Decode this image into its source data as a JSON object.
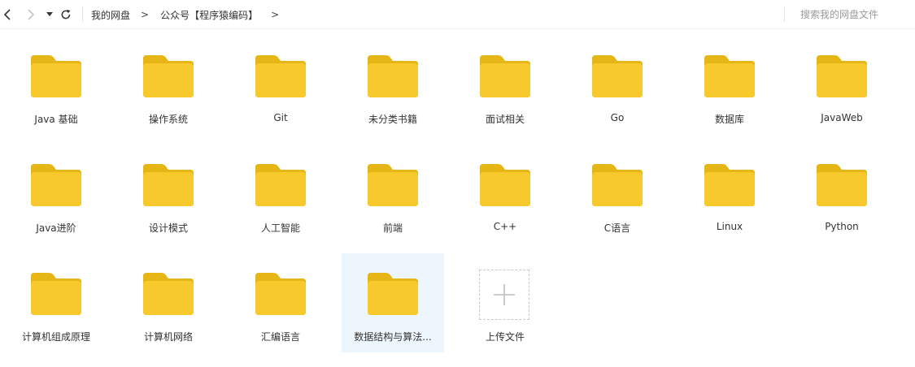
{
  "toolbar": {
    "back_icon": "chevron-left-icon",
    "forward_icon": "chevron-right-icon",
    "history_icon": "caret-down-icon",
    "refresh_icon": "refresh-icon"
  },
  "breadcrumb": {
    "items": [
      "我的网盘",
      "公众号【程序猿编码】"
    ],
    "separator": ">"
  },
  "search": {
    "placeholder": "搜索我的网盘文件"
  },
  "folders": [
    "Java 基础",
    "操作系统",
    "Git",
    "未分类书籍",
    "面试相关",
    "Go",
    "数据库",
    "JavaWeb",
    "Java进阶",
    "设计模式",
    "人工智能",
    "前端",
    "C++",
    "C语言",
    "Linux",
    "Python",
    "计算机组成原理",
    "计算机网络",
    "汇编语言",
    "数据结构与算法..."
  ],
  "selected_folder_index": 19,
  "upload": {
    "label": "上传文件",
    "icon": "plus-icon"
  },
  "colors": {
    "folder_body": "#F8C92C",
    "folder_tab": "#E6B516",
    "selected_bg": "#EEF6FD"
  }
}
